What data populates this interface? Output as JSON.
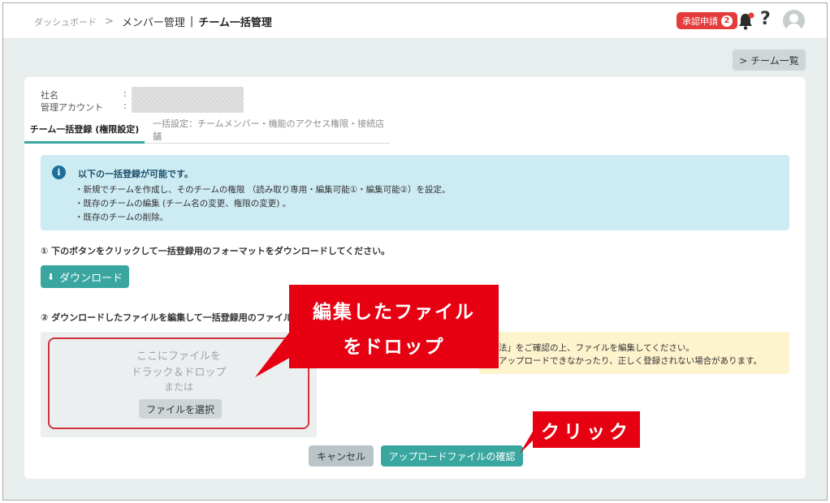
{
  "header": {
    "breadcrumb_home": "ダッシュボード",
    "breadcrumb_sep": ">",
    "breadcrumb_member": "メンバー管理",
    "breadcrumb_bar": "|",
    "breadcrumb_current": "チーム一括管理",
    "approval_label": "承認申請",
    "approval_count": "2",
    "help_symbol": "?"
  },
  "team_list_button": "> チーム一覧",
  "company": {
    "name_label": "社名",
    "account_label": "管理アカウント",
    "colon": ":"
  },
  "tabs": [
    {
      "label": "チーム一括登録 (権限設定)",
      "active": true
    },
    {
      "label": "一括設定：チームメンバー・機能のアクセス権限・接続店舗",
      "active": false
    }
  ],
  "info": {
    "icon_glyph": "i",
    "title": "以下の一括登録が可能です。",
    "lines": [
      "・新規でチームを作成し、そのチームの権限 （読み取り専用・編集可能①・編集可能②）を設定。",
      "・既存のチームの編集 (チーム名の変更、権限の変更) 。",
      "・既存のチームの削除。"
    ]
  },
  "step1": "① 下のボタンをクリックして一括登録用のフォーマットをダウンロードしてください。",
  "download_button": "ダウンロード",
  "download_icon_glyph": "⬇",
  "step2": "② ダウンロードしたファイルを編集して一括登録用のファイルを作",
  "dropzone": {
    "line1": "ここにファイルを",
    "line2": "ドラック＆ドロップ",
    "line3": "または",
    "select_button": "ファイルを選択"
  },
  "warning": {
    "line1": "法」をご確認の上、ファイルを編集してください。",
    "line2": "アップロードできなかったり、正しく登録されない場合があります。"
  },
  "buttons": {
    "cancel": "キャンセル",
    "confirm": "アップロードファイルの確認"
  },
  "annotations": {
    "drop_line1": "編集したファイル",
    "drop_line2": "をドロップ",
    "click": "クリック"
  },
  "colors": {
    "accent": "#3aa6a0",
    "callout": "#e60012",
    "badge": "#e53b3b"
  }
}
